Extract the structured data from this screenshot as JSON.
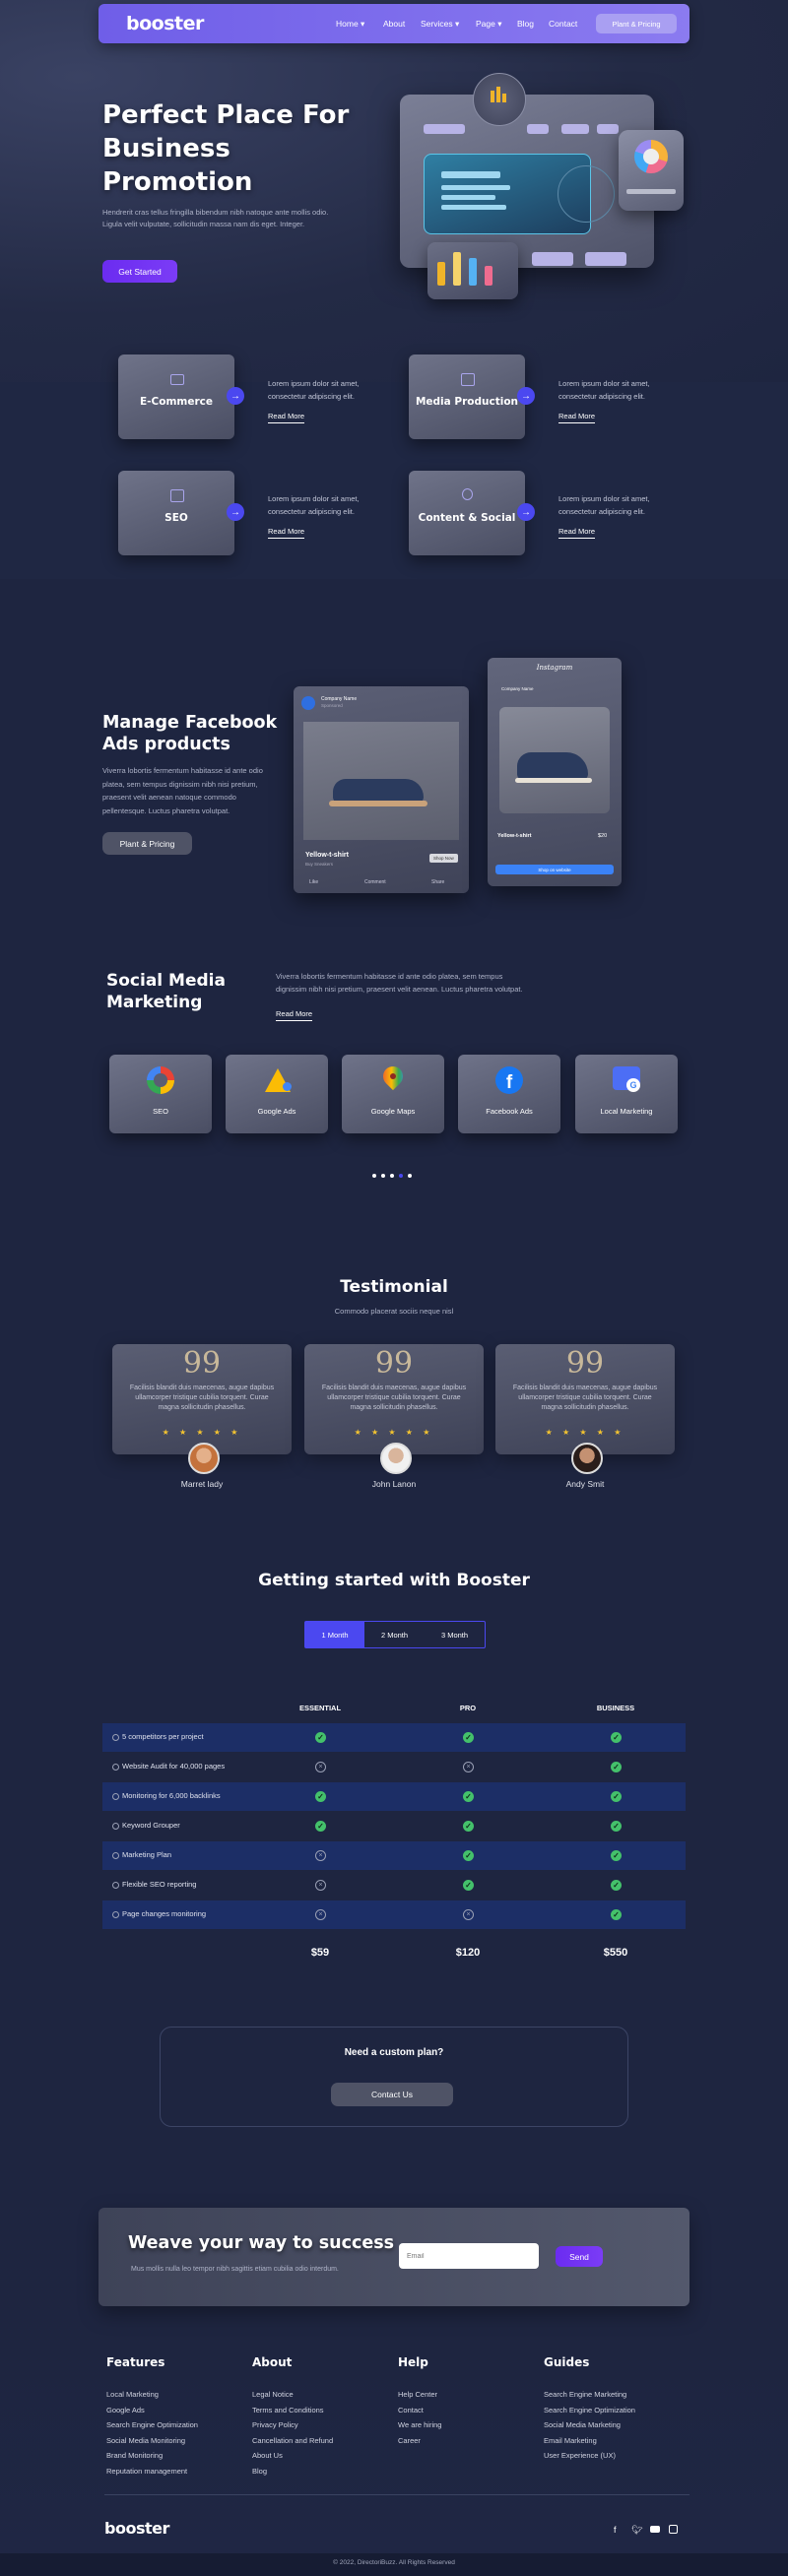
{
  "header": {
    "logo": "booster",
    "nav": [
      "Home ▾",
      "About",
      "Services ▾",
      "Page ▾",
      "Blog",
      "Contact"
    ],
    "cta": "Plant & Pricing"
  },
  "hero": {
    "title_lines": [
      "Perfect Place For",
      "Business",
      "Promotion"
    ],
    "text_lines": [
      "Hendrerit cras tellus fringilla bibendum nibh natoque ante mollis odio.",
      "Ligula velit vulputate, sollicitudin massa nam dis eget. Integer."
    ],
    "cta": "Get Started"
  },
  "services": [
    {
      "title": "E-Commerce",
      "icon": "monitor-icon",
      "text_lines": [
        "Lorem ipsum dolor sit amet,",
        "consectetur adipiscing elit."
      ],
      "link": "Read More"
    },
    {
      "title": "Media Production",
      "icon": "media-icon",
      "text_lines": [
        "Lorem ipsum dolor sit amet,",
        "consectetur adipiscing elit."
      ],
      "link": "Read More"
    },
    {
      "title": "SEO",
      "icon": "seo-icon",
      "text_lines": [
        "Lorem ipsum dolor sit amet,",
        "consectetur adipiscing elit."
      ],
      "link": "Read More"
    },
    {
      "title": "Content & Social",
      "icon": "bulb-icon",
      "text_lines": [
        "Lorem ipsum dolor sit amet,",
        "consectetur adipiscing elit."
      ],
      "link": "Read More"
    }
  ],
  "facebook": {
    "title_lines": [
      "Manage Facebook",
      "Ads products"
    ],
    "text_lines": [
      "Viverra lobortis fermentum habitasse id ante odio",
      "platea, sem tempus dignissim nibh nisi pretium,",
      "praesent velit aenean natoque commodo",
      "pellentesque. Luctus pharetra volutpat."
    ],
    "cta": "Plant & Pricing",
    "fb_post": {
      "company": "Company Name",
      "sub": "Sponsored",
      "product": "Yellow-t-shirt",
      "product_sub": "Buy Sneakers",
      "shop": "Shop Now",
      "actions": [
        "Like",
        "Comment",
        "Share"
      ]
    },
    "ig_post": {
      "brand": "Instagram",
      "company": "Company Name",
      "product": "Yellow-t-shirt",
      "price": "$20",
      "cta": "Shop on website"
    }
  },
  "social": {
    "title_lines": [
      "Social Media",
      "Marketing"
    ],
    "text_lines": [
      "Viverra lobortis fermentum habitasse id ante odio platea, sem tempus",
      "dignissim nibh nisi pretium, praesent velit aenean. Luctus pharetra volutpat."
    ],
    "link": "Read More",
    "platforms": [
      {
        "label": "SEO",
        "icon": "google-icon"
      },
      {
        "label": "Google Ads",
        "icon": "google-ads-icon"
      },
      {
        "label": "Google Maps",
        "icon": "google-maps-icon"
      },
      {
        "label": "Facebook Ads",
        "icon": "facebook-icon"
      },
      {
        "label": "Local Marketing",
        "icon": "local-business-icon"
      }
    ]
  },
  "testimonial": {
    "title": "Testimonial",
    "subtitle": "Commodo placerat sociis neque nisl",
    "quote_mark": "99",
    "stars": "★ ★ ★ ★ ★",
    "items": [
      {
        "text_lines": [
          "Facilisis blandit duis maecenas, augue dapibus",
          "ullamcorper tristique cubilia torquent. Curae",
          "magna sollicitudin phasellus."
        ],
        "name": "Marret lady"
      },
      {
        "text_lines": [
          "Facilisis blandit duis maecenas, augue dapibus",
          "ullamcorper tristique cubilia torquent. Curae",
          "magna sollicitudin phasellus."
        ],
        "name": "John Lanon"
      },
      {
        "text_lines": [
          "Facilisis blandit duis maecenas, augue dapibus",
          "ullamcorper tristique cubilia torquent. Curae",
          "magna sollicitudin phasellus."
        ],
        "name": "Andy Smit"
      }
    ]
  },
  "pricing": {
    "title": "Getting started with Booster",
    "tabs": [
      "1 Month",
      "2 Month",
      "3 Month"
    ],
    "columns": [
      "ESSENTIAL",
      "PRO",
      "BUSINESS"
    ],
    "rows": [
      {
        "label": "5 competitors per project",
        "values": [
          true,
          true,
          true
        ]
      },
      {
        "label": "Website Audit for 40,000 pages",
        "values": [
          false,
          false,
          true
        ]
      },
      {
        "label": "Monitoring for 6,000 backlinks",
        "values": [
          true,
          true,
          true
        ]
      },
      {
        "label": "Keyword Grouper",
        "values": [
          true,
          true,
          true
        ]
      },
      {
        "label": "Marketing Plan",
        "values": [
          false,
          true,
          true
        ]
      },
      {
        "label": "Flexible SEO reporting",
        "values": [
          false,
          true,
          true
        ]
      },
      {
        "label": "Page changes monitoring",
        "values": [
          false,
          false,
          true
        ]
      }
    ],
    "prices": [
      "$59",
      "$120",
      "$550"
    ]
  },
  "custom_plan": {
    "title": "Need a custom plan?",
    "cta": "Contact Us"
  },
  "newsletter": {
    "title": "Weave your way to success",
    "text": "Mus mollis nulla leo tempor nibh sagittis etiam cubilia odio interdum.",
    "placeholder": "Email",
    "cta": "Send"
  },
  "footer": {
    "columns": [
      {
        "title": "Features",
        "links": [
          "Local Marketing",
          "Google Ads",
          "Search Engine Optimization",
          "Social Media Monitoring",
          "Brand Monitoring",
          "Reputation management"
        ]
      },
      {
        "title": "About",
        "links": [
          "Legal Notice",
          "Terms and Conditions",
          "Privacy Policy",
          "Cancellation and Refund",
          "About Us",
          "Blog"
        ]
      },
      {
        "title": "Help",
        "links": [
          "Help Center",
          "Contact",
          "We are hiring",
          "Career"
        ]
      },
      {
        "title": "Guides",
        "links": [
          "Search Engine Marketing",
          "Search Engine Optimization",
          "Social Media Marketing",
          "Email Marketing",
          "User Experience (UX)"
        ]
      }
    ],
    "logo": "booster",
    "social_icons": [
      "facebook-icon",
      "twitter-icon",
      "youtube-icon",
      "instagram-icon"
    ],
    "copyright": "© 2022, DirectoriBuzz. All Rights Reserved"
  },
  "colors": {
    "background": "#1e2540",
    "accent": "#7b3cf6",
    "header": "#7a6cee",
    "arrow": "#4b48f0",
    "check": "#44c16b",
    "row_highlight": "#1c2e66"
  }
}
